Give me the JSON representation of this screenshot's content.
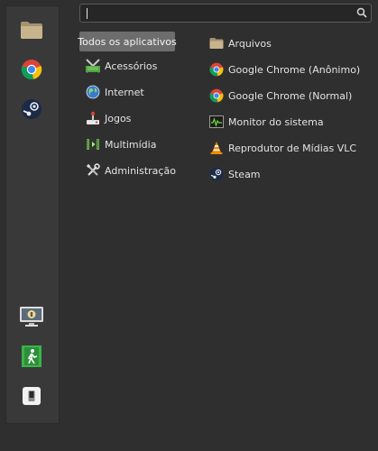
{
  "search": {
    "value": "",
    "placeholder": ""
  },
  "favorites": [
    {
      "icon": "folder-icon"
    },
    {
      "icon": "chrome-icon"
    },
    {
      "icon": "steam-icon"
    }
  ],
  "session": [
    {
      "icon": "lock-screen-icon"
    },
    {
      "icon": "logout-icon"
    },
    {
      "icon": "shutdown-icon"
    }
  ],
  "categories": [
    {
      "label": "Todos os aplicativos",
      "icon": ""
    },
    {
      "label": "Acessórios",
      "icon": "accessories-icon"
    },
    {
      "label": "Internet",
      "icon": "internet-icon"
    },
    {
      "label": "Jogos",
      "icon": "games-icon"
    },
    {
      "label": "Multimídia",
      "icon": "multimedia-icon"
    },
    {
      "label": "Administração",
      "icon": "administration-icon"
    }
  ],
  "apps": [
    {
      "label": "Arquivos",
      "icon": "folder-icon"
    },
    {
      "label": "Google Chrome (Anônimo)",
      "icon": "chrome-icon"
    },
    {
      "label": "Google Chrome (Normal)",
      "icon": "chrome-icon"
    },
    {
      "label": "Monitor do sistema",
      "icon": "system-monitor-icon"
    },
    {
      "label": "Reprodutor de Mídias VLC",
      "icon": "vlc-icon"
    },
    {
      "label": "Steam",
      "icon": "steam-icon"
    }
  ],
  "colors": {
    "background": "#2f2f2f",
    "rail": "#393939",
    "active_category": "#6d6d6d"
  }
}
